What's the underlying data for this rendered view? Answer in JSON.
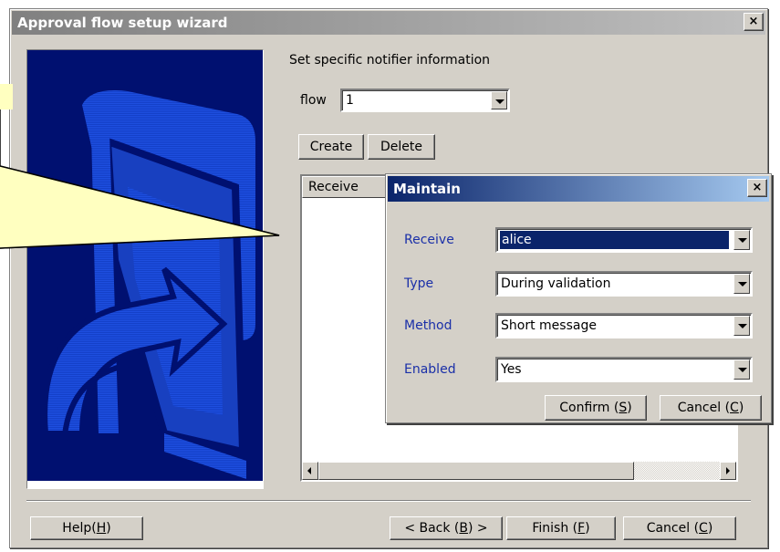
{
  "wizard": {
    "title": "Approval flow setup wizard",
    "close_label": "×",
    "heading": "Set specific notifier information",
    "flow_label": "flow",
    "flow_value": "1",
    "create_label": "Create",
    "delete_label": "Delete",
    "list_header": "Receive",
    "buttons": {
      "help_prefix": "Help(",
      "help_key": "H",
      "help_suffix": ")",
      "back_prefix": "< Back (",
      "back_key": "B",
      "back_suffix": ") >",
      "finish_prefix": "Finish (",
      "finish_key": "F",
      "finish_suffix": ")",
      "cancel_prefix": "Cancel (",
      "cancel_key": "C",
      "cancel_suffix": ")"
    }
  },
  "dialog": {
    "title": "Maintain",
    "close_label": "×",
    "fields": [
      {
        "label": "Receive",
        "value": "alice"
      },
      {
        "label": "Type",
        "value": "During validation"
      },
      {
        "label": "Method",
        "value": "Short message"
      },
      {
        "label": "Enabled",
        "value": "Yes"
      }
    ],
    "confirm_prefix": "Confirm (",
    "confirm_key": "S",
    "confirm_suffix": ")",
    "cancel_prefix": "Cancel (",
    "cancel_key": "C",
    "cancel_suffix": ")"
  },
  "colors": {
    "window_bg": "#d4d0c8",
    "active_title": "#0a246a",
    "inactive_title": "#808080",
    "field_label": "#1a2fa8",
    "callout_fill": "#ffffc0",
    "side_image_bg": "#001070"
  },
  "icons": [
    "close-icon",
    "dropdown-arrow-icon",
    "scroll-left-icon",
    "scroll-right-icon",
    "wizard-logo-icon"
  ]
}
